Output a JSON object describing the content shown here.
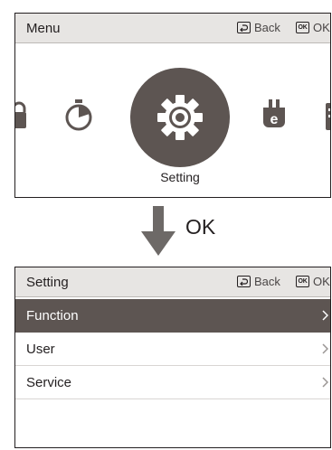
{
  "menu_screen": {
    "title": "Menu",
    "back_label": "Back",
    "ok_label": "OK",
    "carousel": {
      "selected_label": "Setting",
      "items": [
        "lock-icon",
        "timer-icon",
        "gear-icon",
        "energy-plug-icon"
      ]
    }
  },
  "transition": {
    "label": "OK"
  },
  "setting_screen": {
    "title": "Setting",
    "back_label": "Back",
    "ok_label": "OK",
    "items": [
      {
        "label": "Function",
        "selected": true
      },
      {
        "label": "User",
        "selected": false
      },
      {
        "label": "Service",
        "selected": false
      }
    ]
  },
  "colors": {
    "highlight": "#5d5552",
    "header_bg": "#e7e5e3",
    "text": "#231f20"
  }
}
